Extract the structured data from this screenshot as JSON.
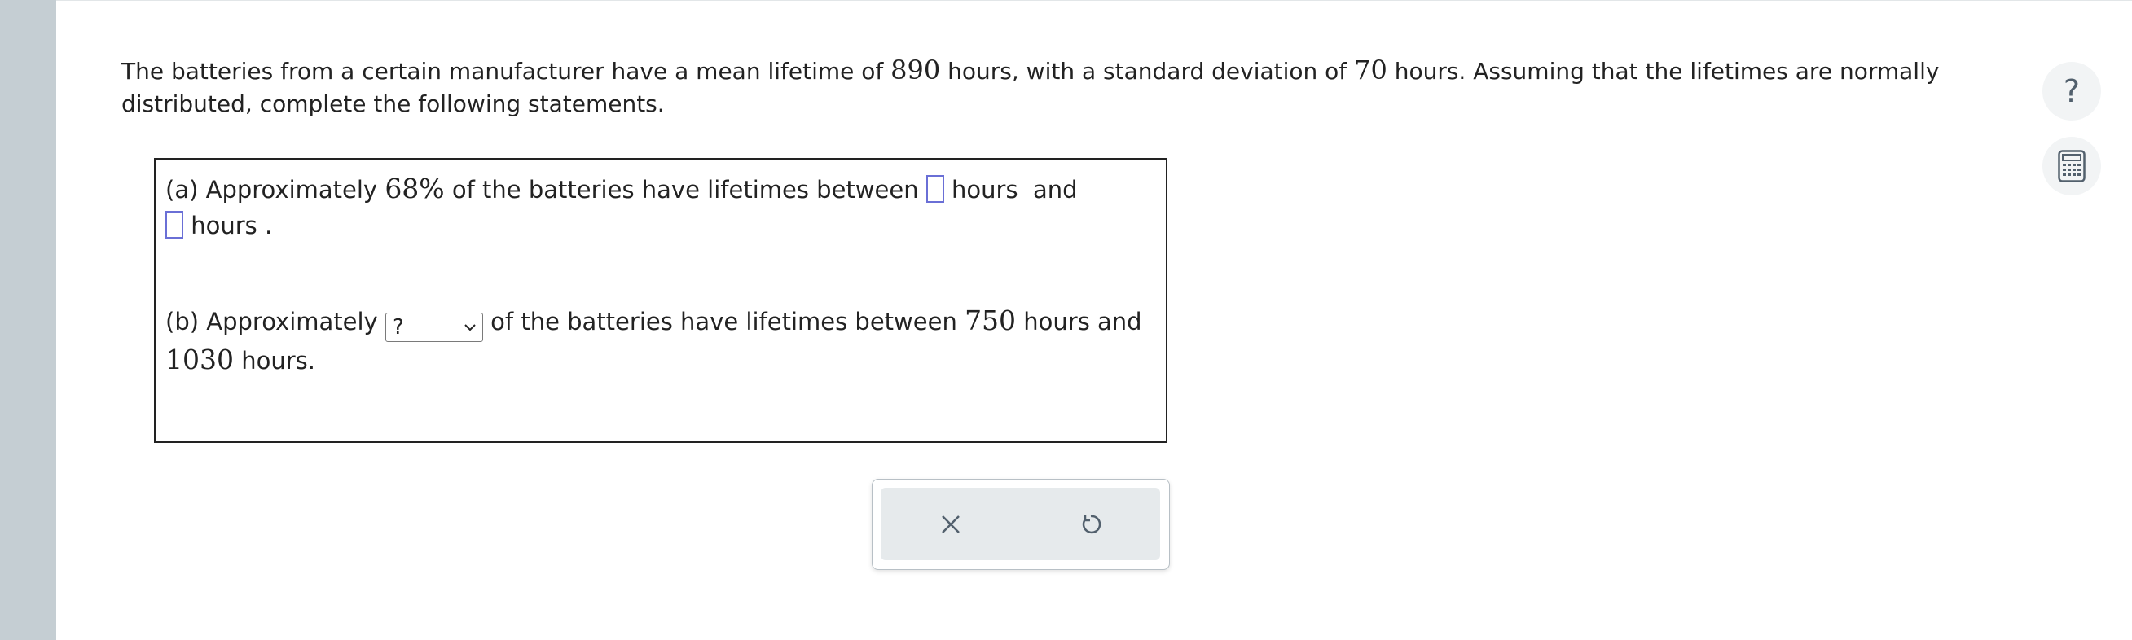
{
  "question": {
    "intro_1": "The batteries from a certain manufacturer have a mean lifetime of ",
    "mean": "890",
    "intro_2": " hours, with a standard deviation of ",
    "sd": "70",
    "intro_3": " hours. Assuming that the lifetimes are normally distributed, complete the following statements."
  },
  "part_a": {
    "prefix": "(a) Approximately ",
    "percent": "68%",
    "middle": " of the batteries have lifetimes between ",
    "unit_1": "hours",
    "and": "and",
    "unit_2": "hours",
    "period": ".",
    "blank_1_value": "",
    "blank_2_value": ""
  },
  "part_b": {
    "prefix": "(b) Approximately ",
    "select_value": "?",
    "middle": " of the batteries have lifetimes between ",
    "low": "750",
    "middle_2": " hours and",
    "high": "1030",
    "suffix": " hours."
  },
  "icons": {
    "help": "question-mark-icon",
    "calculator": "calculator-icon",
    "clear": "close-icon",
    "undo": "undo-icon"
  },
  "side": {
    "help_glyph": "?"
  },
  "colors": {
    "rail": "#c5ced3",
    "blank_border": "#6a6fd6",
    "action_bg": "#e6eaec",
    "icon": "#52606d"
  }
}
